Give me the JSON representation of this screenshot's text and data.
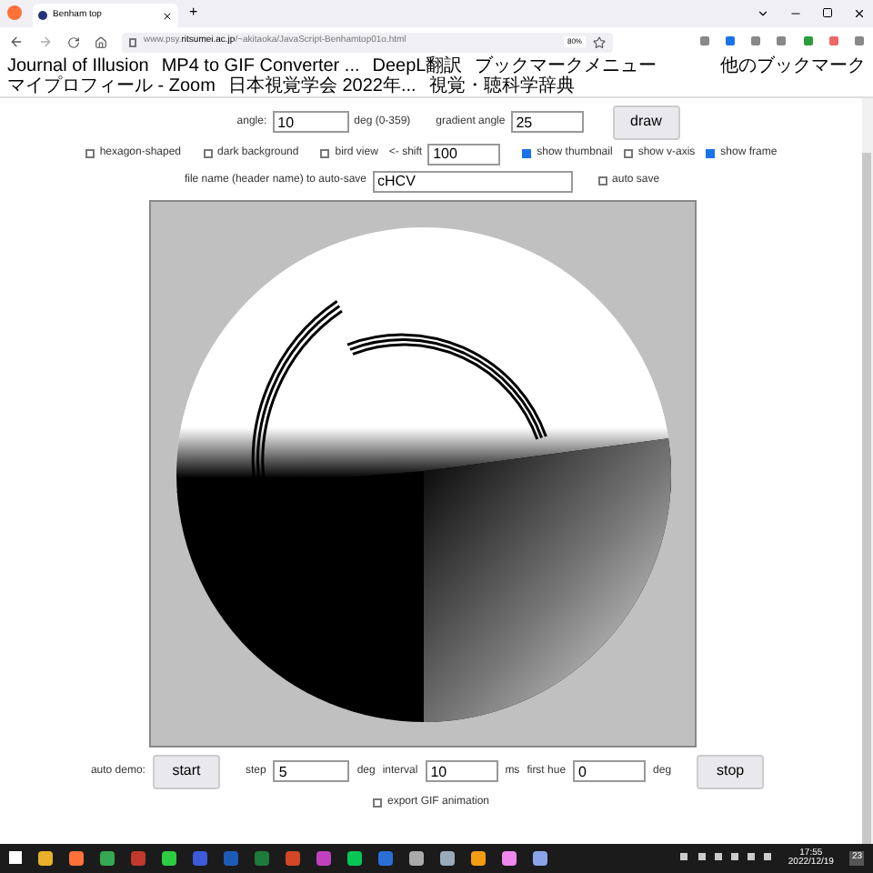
{
  "browser": {
    "tabs": [
      {
        "title": "Benham top",
        "selected": true
      }
    ],
    "new_tab": "+",
    "url": {
      "prefix": "www.psy.",
      "domain": "ritsumei.ac.jp",
      "path": "/~akitaoka/JavaScript-Benhamtop01o.html"
    },
    "zoom": "80%"
  },
  "bookmarks": [
    "Journal of Illusion",
    "MP4 to GIF Converter ...",
    "DeepL翻訳",
    "ブックマークメニュー",
    "マイプロフィール - Zoom",
    "日本視覚学会 2022年...",
    "視覚・聴科学辞典"
  ],
  "other_bookmarks": "他のブックマーク",
  "controls": {
    "angle_label": "angle:",
    "angle": "10",
    "angle_unit": "deg (0-359)",
    "gradient_label": "gradient angle",
    "gradient": "25",
    "draw": "draw",
    "options": [
      {
        "label": "hexagon-shaped",
        "checked": false
      },
      {
        "label": "dark background",
        "checked": false
      },
      {
        "label": "bird view",
        "checked": false
      }
    ],
    "shift_label": "<- shift",
    "shift": "100",
    "options2": [
      {
        "label": "show thumbnail",
        "checked": true
      },
      {
        "label": "show v-axis",
        "checked": false
      },
      {
        "label": "show frame",
        "checked": true
      }
    ],
    "file_label": "file name (header name) to auto-save",
    "file": "cHCV",
    "auto_save": {
      "label": "auto save",
      "checked": false
    }
  },
  "demo": {
    "label": "auto demo:",
    "start": "start",
    "step_label": "step",
    "step": "5",
    "step_unit": "deg",
    "interval_label": "interval",
    "interval": "10",
    "interval_unit": "ms",
    "hue_label": "first hue",
    "hue": "0",
    "hue_unit": "deg",
    "stop": "stop",
    "export": {
      "label": "export GIF animation",
      "checked": false
    }
  },
  "taskbar": {
    "time": "17:55",
    "date": "2022/12/19",
    "badge": "23"
  }
}
